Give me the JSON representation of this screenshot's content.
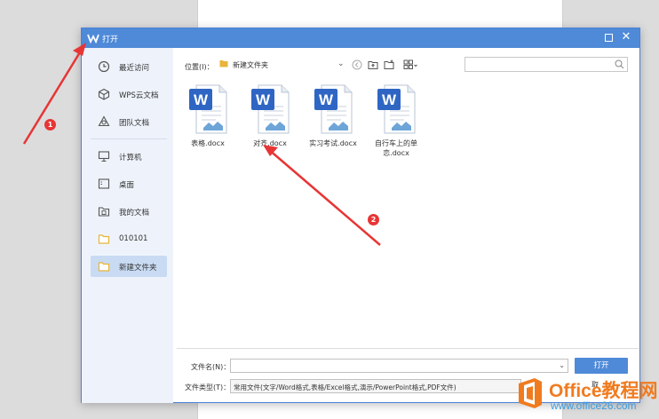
{
  "dialog": {
    "title": "打开",
    "colors": {
      "accent": "#4f8ad8",
      "sidebar_bg": "#eef3fb",
      "active_item": "#c9dbf3"
    }
  },
  "sidebar": {
    "items": [
      {
        "label": "最近访问",
        "icon": "clock-icon"
      },
      {
        "label": "WPS云文档",
        "icon": "cloud-cube-icon"
      },
      {
        "label": "团队文档",
        "icon": "team-icon"
      },
      {
        "label": "计算机",
        "icon": "computer-icon"
      },
      {
        "label": "桌面",
        "icon": "desktop-icon"
      },
      {
        "label": "我的文档",
        "icon": "documents-icon"
      },
      {
        "label": "010101",
        "icon": "folder-icon"
      },
      {
        "label": "新建文件夹",
        "icon": "folder-icon",
        "active": true
      }
    ]
  },
  "toolbar": {
    "location_label": "位置(I)：",
    "location_value": "新建文件夹",
    "search_placeholder": ""
  },
  "files": [
    {
      "name": "表格.docx"
    },
    {
      "name": "对齐.docx"
    },
    {
      "name": "实习考试.docx"
    },
    {
      "name": "自行车上的单恋.docx"
    }
  ],
  "footer": {
    "filename_label": "文件名(N)：",
    "filename_value": "",
    "open_label": "打开",
    "filetype_label": "文件类型(T)：",
    "filetype_value": "常用文件(文字/Word格式,表格/Excel格式,演示/PowerPoint格式,PDF文件)",
    "cancel_label": "取"
  },
  "annotations": [
    {
      "label": "1"
    },
    {
      "label": "2"
    }
  ],
  "watermark": {
    "brand": "Office教程网",
    "url": "www.office26.com"
  }
}
